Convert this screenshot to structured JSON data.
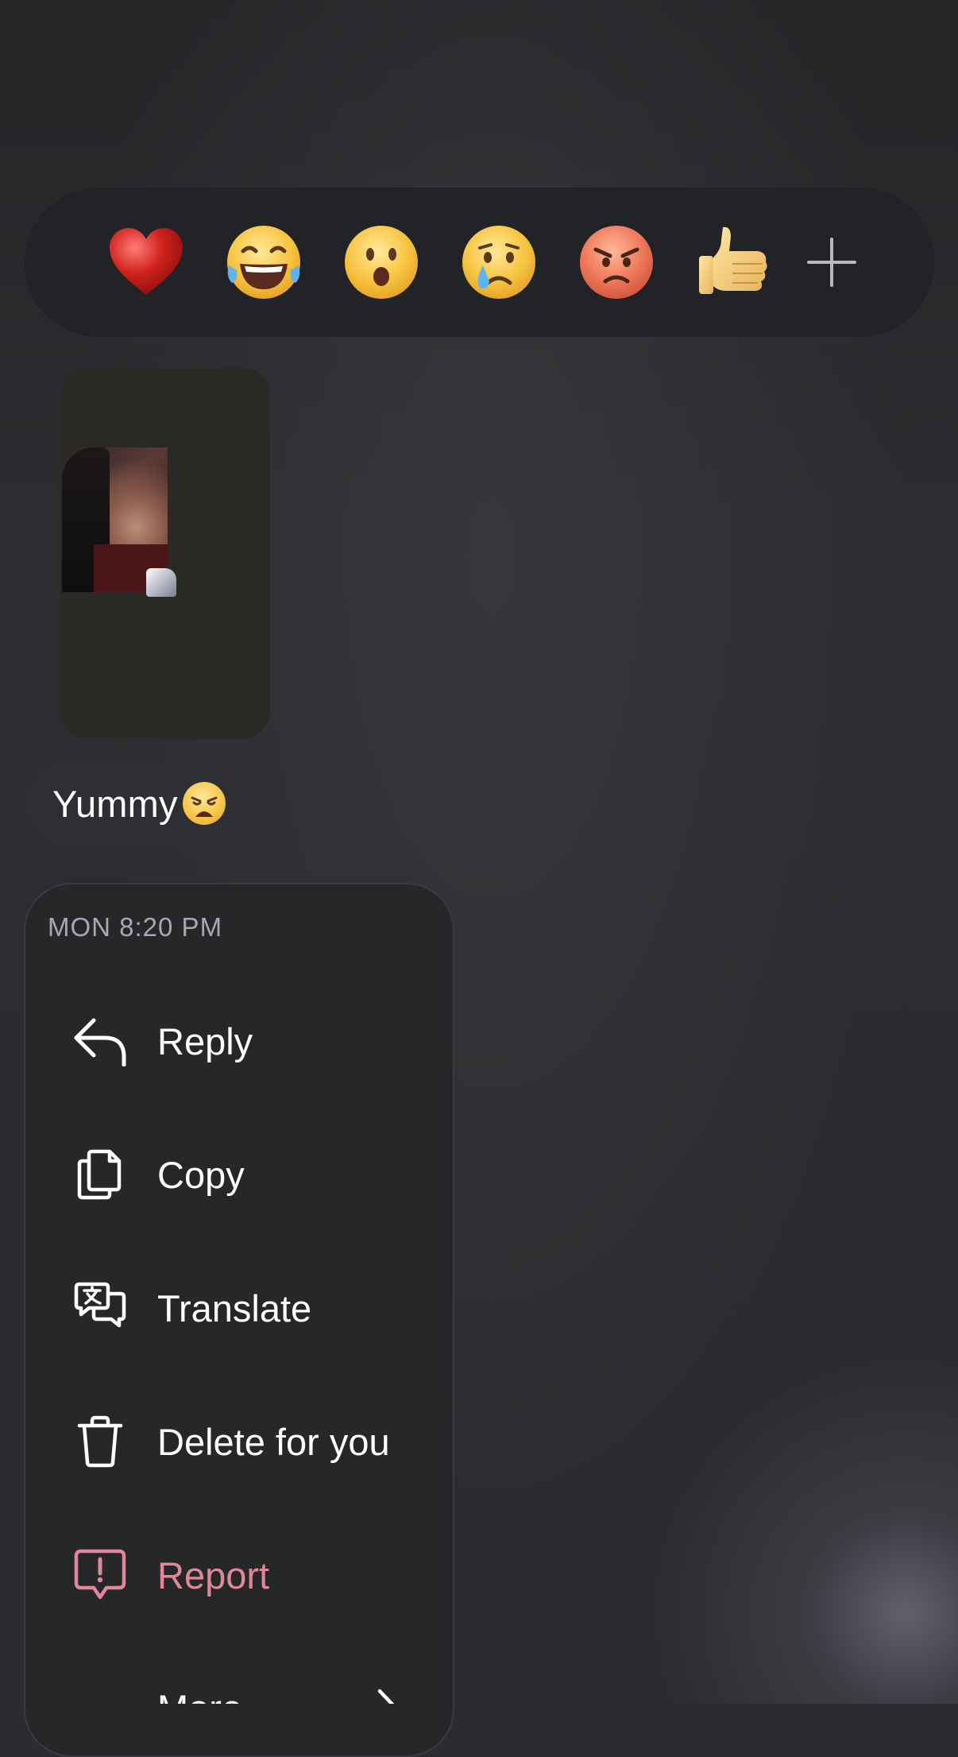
{
  "reactions": {
    "items": [
      {
        "name": "heart",
        "emoji": "❤️"
      },
      {
        "name": "laughing-tears",
        "emoji": "😂"
      },
      {
        "name": "surprised",
        "emoji": "😮"
      },
      {
        "name": "crying",
        "emoji": "😢"
      },
      {
        "name": "angry",
        "emoji": "😡"
      },
      {
        "name": "thumbs-up",
        "emoji": "👍"
      }
    ],
    "add_icon": "plus-icon"
  },
  "messages": [
    {
      "type": "image",
      "description_icon": "photo-thumbnail"
    },
    {
      "type": "text",
      "text": "Yummy",
      "emoji": "😩"
    }
  ],
  "menu": {
    "timestamp": "MON 8:20 PM",
    "items": [
      {
        "label": "Reply",
        "icon": "reply-icon"
      },
      {
        "label": "Copy",
        "icon": "copy-icon"
      },
      {
        "label": "Translate",
        "icon": "translate-icon"
      },
      {
        "label": "Delete for you",
        "icon": "trash-icon"
      },
      {
        "label": "Report",
        "icon": "report-icon",
        "color": "#e0889a"
      },
      {
        "label": "More",
        "icon": "chevron-right-icon"
      }
    ]
  },
  "colors": {
    "background": "#2b2c2f",
    "menu_background": "#262729",
    "report_accent": "#e0889a",
    "timestamp_text": "#a8a9ae"
  }
}
